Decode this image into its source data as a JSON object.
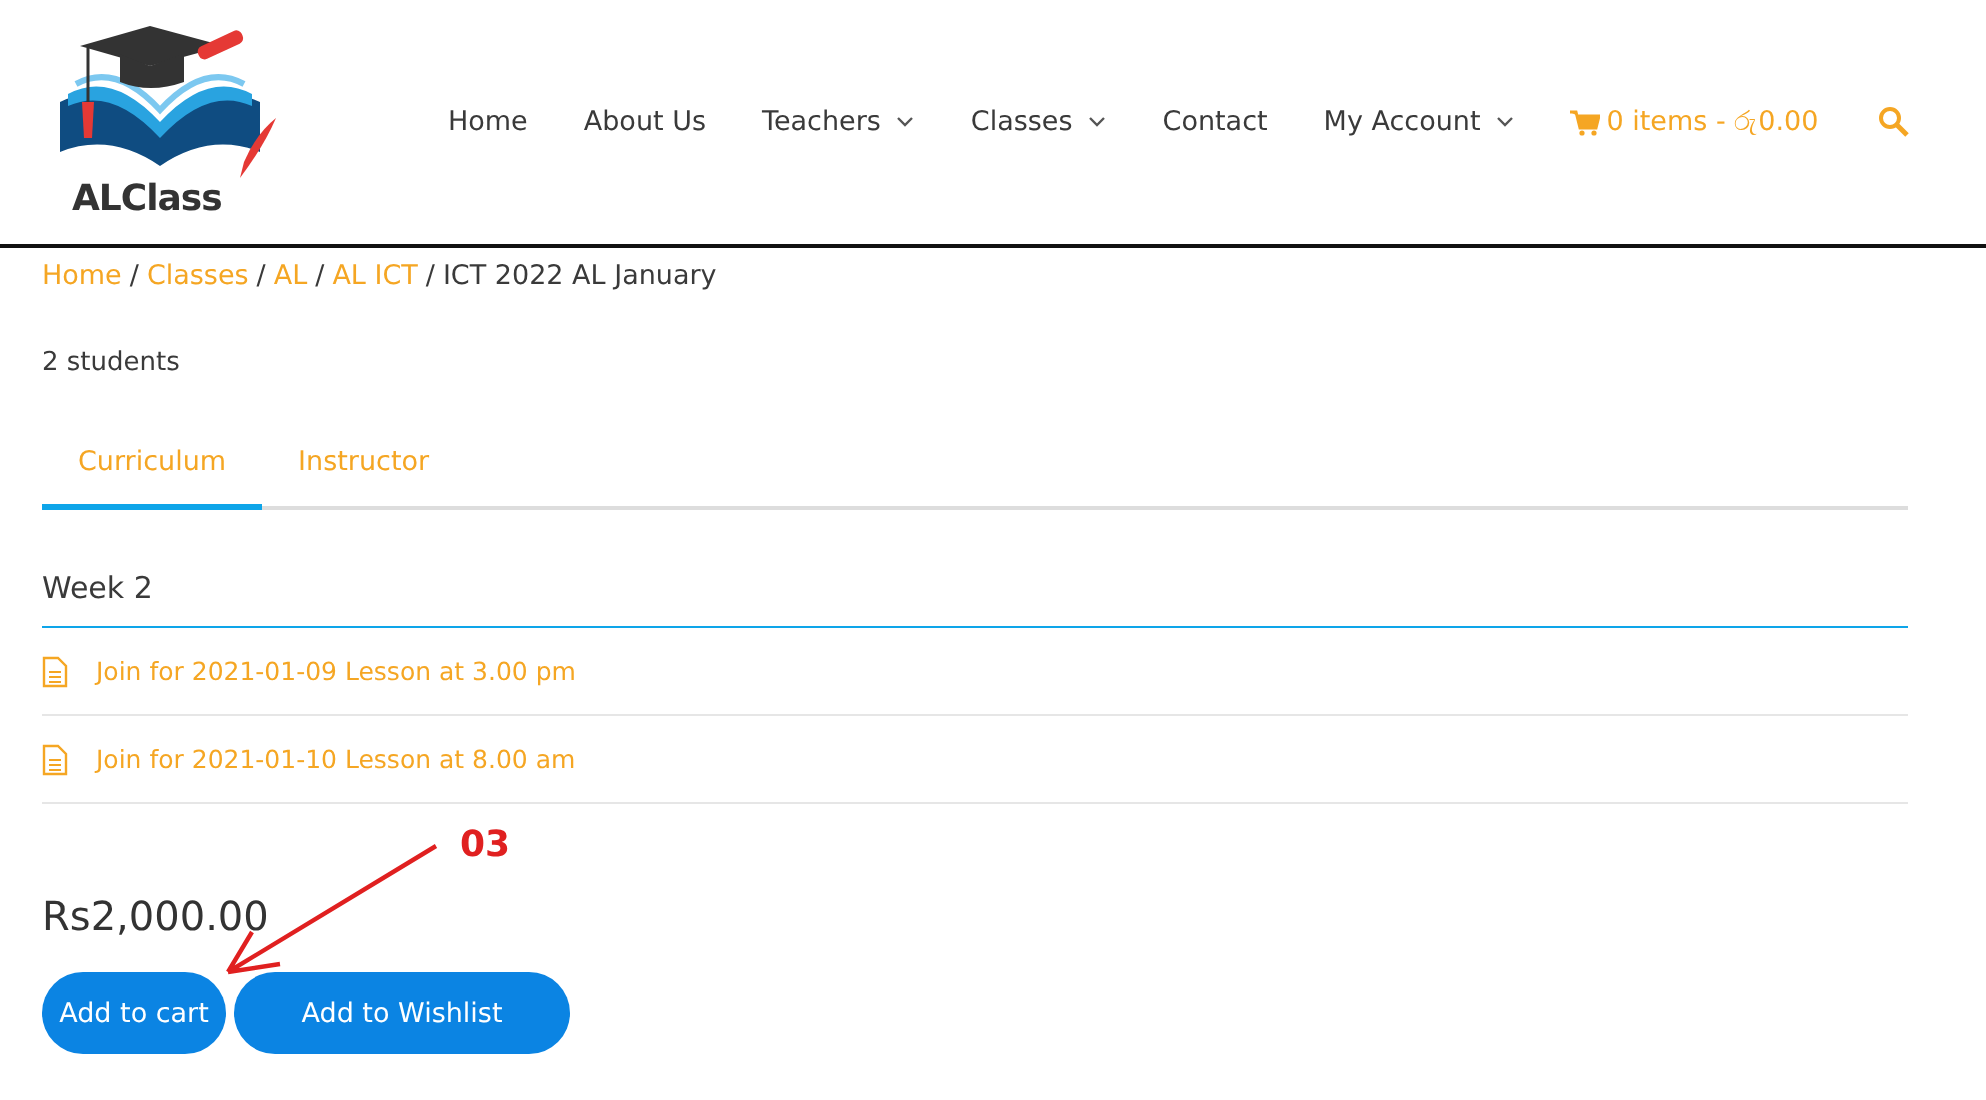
{
  "logo": {
    "text": "ALClass"
  },
  "nav": [
    {
      "label": "Home",
      "has_menu": false
    },
    {
      "label": "About Us",
      "has_menu": false
    },
    {
      "label": "Teachers",
      "has_menu": true
    },
    {
      "label": "Classes",
      "has_menu": true
    },
    {
      "label": "Contact",
      "has_menu": false
    },
    {
      "label": "My Account",
      "has_menu": true
    }
  ],
  "cart": {
    "label": "0 items - රු0.00"
  },
  "breadcrumb_separator": "/",
  "breadcrumb": [
    {
      "label": "Home",
      "link": true
    },
    {
      "label": "Classes",
      "link": true
    },
    {
      "label": "AL",
      "link": true
    },
    {
      "label": "AL ICT",
      "link": true
    },
    {
      "label": "ICT 2022 AL January",
      "link": false
    }
  ],
  "students": "2 students",
  "tabs": [
    {
      "label": "Curriculum",
      "selected": true
    },
    {
      "label": "Instructor",
      "selected": false
    }
  ],
  "section": {
    "title": "Week 2",
    "lessons": [
      "Join for 2021-01-09 Lesson at 3.00 pm",
      "Join for 2021-01-10 Lesson at 8.00 am"
    ]
  },
  "price": "Rs2,000.00",
  "buttons": [
    "Add to cart",
    "Add to Wishlist"
  ],
  "annotation": {
    "label": "03"
  }
}
